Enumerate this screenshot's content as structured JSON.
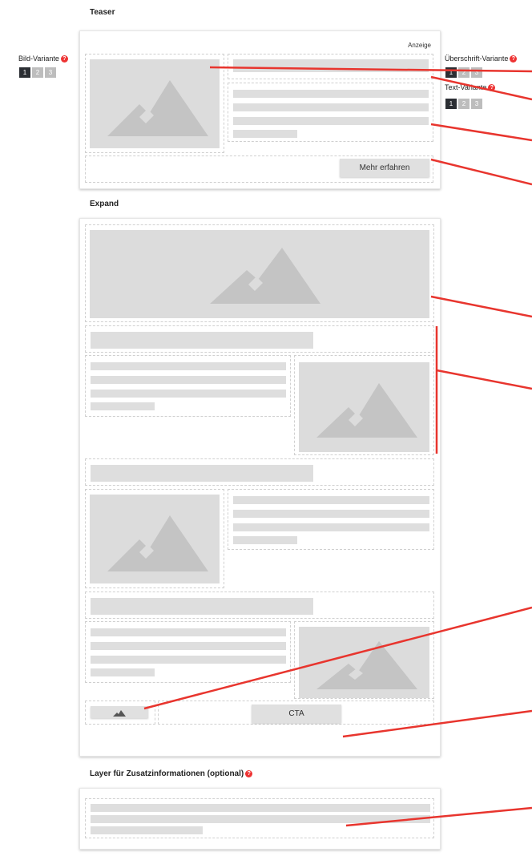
{
  "sections": {
    "teaser": "Teaser",
    "expand": "Expand",
    "layer": "Layer für Zusatzinformationen (optional)"
  },
  "teaser": {
    "ad_label": "Anzeige",
    "cta_label": "Mehr erfahren"
  },
  "expand": {
    "cta_label": "CTA"
  },
  "controls": {
    "bild": {
      "label": "Bild-Variante",
      "options": [
        "1",
        "2",
        "3"
      ],
      "selected": "1"
    },
    "ueberschrift": {
      "label": "Überschrift-Variante",
      "options": [
        "1",
        "2",
        "3"
      ],
      "selected": "1"
    },
    "text": {
      "label": "Text-Variante",
      "options": [
        "1",
        "2",
        "3"
      ],
      "selected": "1"
    },
    "help_glyph": "?"
  },
  "icons": {
    "image": "mountain-icon",
    "help": "question-icon"
  },
  "colors": {
    "accent_arrow": "#e8352e",
    "selected_segment": "#2b2e33",
    "placeholder": "#dedede"
  }
}
